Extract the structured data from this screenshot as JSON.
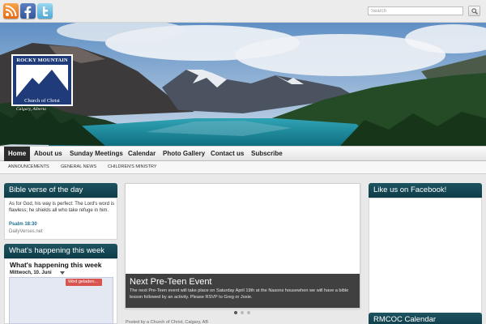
{
  "colors": {
    "widget_header": "#124552",
    "nav_active": "#2b2b2b",
    "event": "#d9534f"
  },
  "social": [
    {
      "name": "rss-icon"
    },
    {
      "name": "facebook-icon"
    },
    {
      "name": "twitter-icon"
    }
  ],
  "search": {
    "placeholder": "Search"
  },
  "logo": {
    "line1": "ROCKY MOUNTAIN",
    "line2": "Church of Christ",
    "city": "Calgary, Alberta"
  },
  "nav": {
    "items": [
      "Home",
      "About us",
      "Sunday Meetings",
      "Calendar",
      "Photo Gallery",
      "Contact us",
      "Subscribe"
    ],
    "active": "Home"
  },
  "subnav": {
    "items": [
      "ANNOUNCEMENTS",
      "GENERAL NEWS",
      "CHILDREN'S MINISTRY"
    ]
  },
  "bible": {
    "title": "Bible verse of the day",
    "text": "As for God, his way is perfect: The Lord's word is flawless; he shields all who take refuge in him.",
    "reference": "Psalm 18:30",
    "source": "DailyVerses.net"
  },
  "happening": {
    "title": "What's happening this week",
    "heading": "What's happening this week",
    "date": "Mittwoch, 10. Juni",
    "event": "Wird geladen..."
  },
  "slider": {
    "title": "Next Pre-Teen Event",
    "text": "The next Pre-Teen event will take place on Saturday April 19th at the Nasons housewhen we will have a bible lesson followed by an activity. Please RSVP to Greg or Josie.",
    "slides": 3,
    "current": 1
  },
  "facebook": {
    "title": "Like us on Facebook!"
  },
  "calendar": {
    "title": "RMCOC Calendar"
  },
  "below": {
    "text": "Posted by a Church of Christ, Calgary, AB"
  }
}
